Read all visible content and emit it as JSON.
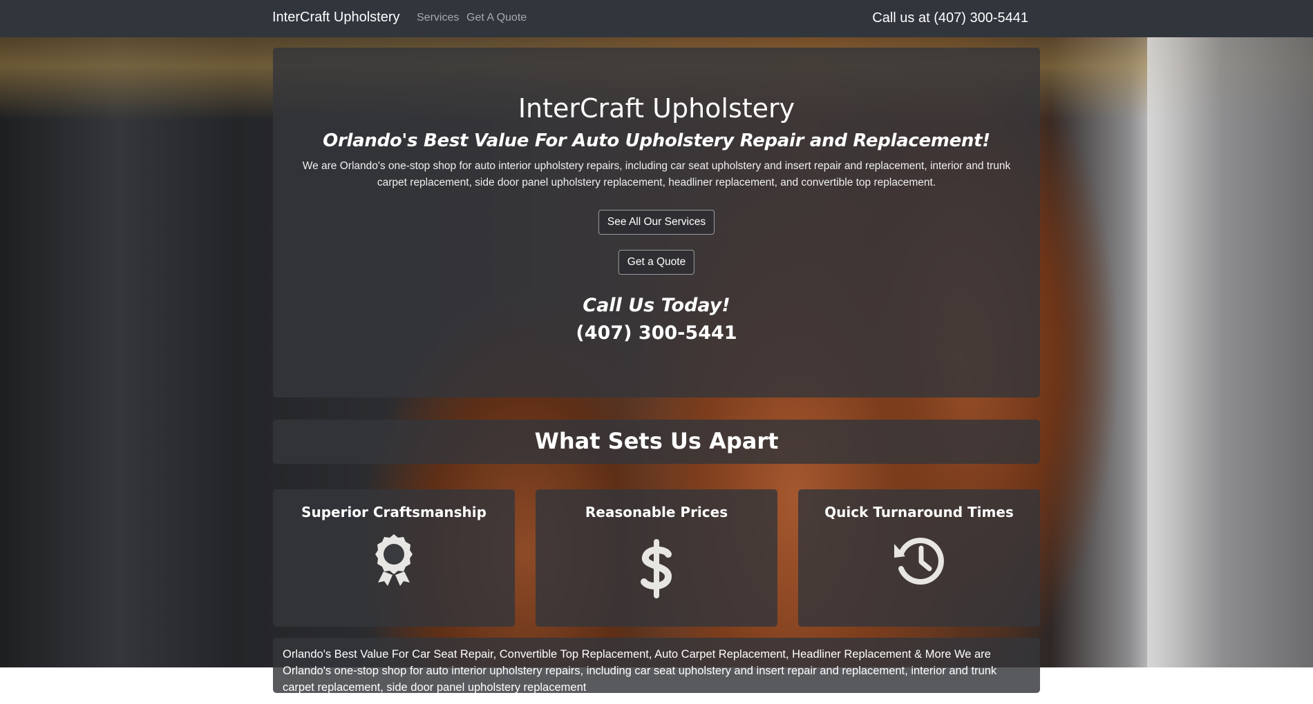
{
  "navbar": {
    "brand": "InterCraft Upholstery",
    "links": [
      {
        "label": "Services"
      },
      {
        "label": "Get A Quote"
      }
    ],
    "phone": "Call us at (407) 300-5441"
  },
  "hero": {
    "title": "InterCraft Upholstery",
    "subtitle": "Orlando's Best Value For Auto Upholstery Repair and Replacement!",
    "description": "We are Orlando's one-stop shop for auto interior upholstery repairs, including car seat upholstery and insert repair and replacement, interior and trunk carpet replacement, side door panel upholstery replacement, headliner replacement, and convertible top replacement.",
    "services_button": "See All Our Services",
    "quote_button": "Get a Quote",
    "call_heading": "Call Us Today!",
    "phone": "(407) 300-5441"
  },
  "apart": {
    "heading": "What Sets Us Apart"
  },
  "features": [
    {
      "title": "Superior Craftsmanship",
      "icon": "award-ribbon-icon"
    },
    {
      "title": "Reasonable Prices",
      "icon": "dollar-sign-icon"
    },
    {
      "title": "Quick Turnaround Times",
      "icon": "history-clock-icon"
    }
  ],
  "bottom": {
    "text": "Orlando's Best Value For Car Seat Repair, Convertible Top Replacement, Auto Carpet Replacement, Headliner Replacement & More We are Orlando's one-stop shop for auto interior upholstery repairs, including car seat upholstery and insert repair and replacement, interior and trunk carpet replacement, side door panel upholstery replacement"
  },
  "colors": {
    "navbar": "#31353c",
    "panel": "#34363a",
    "text": "#ffffff",
    "nav_link": "#a8aaad",
    "icon": "#e8e6e3"
  }
}
